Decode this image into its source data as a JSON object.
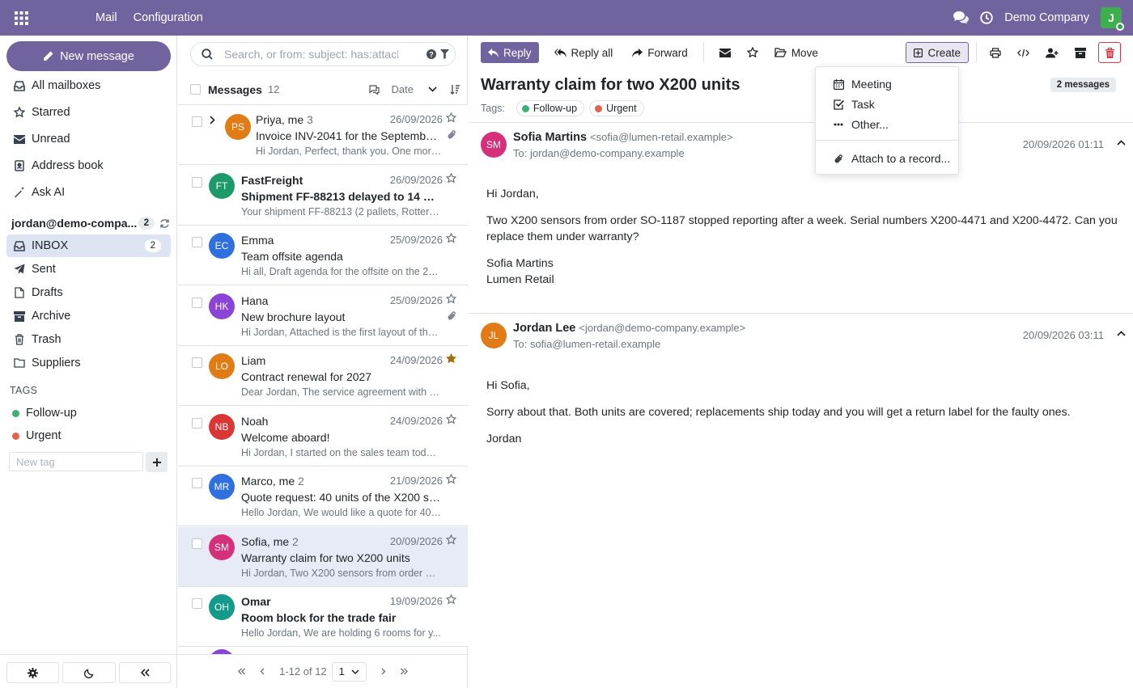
{
  "topbar": {
    "menu": [
      "Mail",
      "Configuration"
    ],
    "company": "Demo Company",
    "user_initial": "J",
    "bg_color": "#71639e"
  },
  "sidebar": {
    "new_message": "New message",
    "quick": [
      {
        "label": "All mailboxes",
        "icon": "inbox-icon"
      },
      {
        "label": "Starred",
        "icon": "star-icon"
      },
      {
        "label": "Unread",
        "icon": "envelope-icon"
      },
      {
        "label": "Address book",
        "icon": "address-book-icon"
      },
      {
        "label": "Ask AI",
        "icon": "magic-wand-icon"
      }
    ],
    "account": {
      "name": "jordan@demo-compa...",
      "count": "2"
    },
    "folders": [
      {
        "label": "INBOX",
        "count": "2",
        "icon": "inbox-icon",
        "active": true
      },
      {
        "label": "Sent",
        "icon": "send-icon"
      },
      {
        "label": "Drafts",
        "icon": "file-icon"
      },
      {
        "label": "Archive",
        "icon": "archive-icon"
      },
      {
        "label": "Trash",
        "icon": "trash-icon"
      },
      {
        "label": "Suppliers",
        "icon": "folder-icon"
      }
    ],
    "tags_title": "TAGS",
    "tags": [
      {
        "label": "Follow-up",
        "color": "#3bb273"
      },
      {
        "label": "Urgent",
        "color": "#e8604c"
      }
    ],
    "new_tag_placeholder": "New tag"
  },
  "list": {
    "search_placeholder": "Search, or from: subject: has:attachm",
    "header": {
      "title": "Messages",
      "count": "12",
      "sort": "Date"
    },
    "messages": [
      {
        "initials": "PS",
        "color": "#e07b16",
        "from": "Priya, me",
        "count": "3",
        "date": "26/09/2026",
        "subject": "Invoice INV-2041 for the September ...",
        "preview": "Hi Jordan, Perfect, thank you. One more ...",
        "unread": false,
        "starred": false,
        "attachment": true,
        "thread": true,
        "selected": false
      },
      {
        "initials": "FT",
        "color": "#1e9a6a",
        "from": "FastFreight",
        "count": "",
        "date": "26/09/2026",
        "subject": "Shipment FF-88213 delayed to 14 Octo...",
        "preview": "Your shipment FF-88213 (2 pallets, Rotterda...",
        "unread": true,
        "starred": false,
        "attachment": false,
        "thread": false,
        "selected": false
      },
      {
        "initials": "EC",
        "color": "#2f6fde",
        "from": "Emma",
        "count": "",
        "date": "25/09/2026",
        "subject": "Team offsite agenda",
        "preview": "Hi all, Draft agenda for the offsite on the 24...",
        "unread": false,
        "starred": false,
        "attachment": false,
        "thread": false,
        "selected": false
      },
      {
        "initials": "HK",
        "color": "#8a44d6",
        "from": "Hana",
        "count": "",
        "date": "25/09/2026",
        "subject": "New brochure layout",
        "preview": "Hi Jordan, Attached is the first layout of the ...",
        "unread": false,
        "starred": false,
        "attachment": true,
        "thread": false,
        "selected": false
      },
      {
        "initials": "LO",
        "color": "#e07b16",
        "from": "Liam",
        "count": "",
        "date": "24/09/2026",
        "subject": "Contract renewal for 2027",
        "preview": "Dear Jordan, The service agreement with Lu...",
        "unread": false,
        "starred": true,
        "attachment": false,
        "thread": false,
        "selected": false
      },
      {
        "initials": "NB",
        "color": "#d93636",
        "from": "Noah",
        "count": "",
        "date": "24/09/2026",
        "subject": "Welcome aboard!",
        "preview": "Hi Jordan, I started on the sales team today....",
        "unread": false,
        "starred": false,
        "attachment": false,
        "thread": false,
        "selected": false
      },
      {
        "initials": "MR",
        "color": "#2f6fde",
        "from": "Marco, me",
        "count": "2",
        "date": "21/09/2026",
        "subject": "Quote request: 40 units of the X200 sens...",
        "preview": "Hello Jordan, We would like a quote for 40 ...",
        "unread": false,
        "starred": false,
        "attachment": false,
        "thread": false,
        "selected": false
      },
      {
        "initials": "SM",
        "color": "#d62f7c",
        "from": "Sofia, me",
        "count": "2",
        "date": "20/09/2026",
        "subject": "Warranty claim for two X200 units",
        "preview": "Hi Jordan, Two X200 sensors from order SO...",
        "unread": false,
        "starred": false,
        "attachment": false,
        "thread": false,
        "selected": true
      },
      {
        "initials": "OH",
        "color": "#139a8a",
        "from": "Omar",
        "count": "",
        "date": "19/09/2026",
        "subject": "Room block for the trade fair",
        "preview": "Hello Jordan, We are holding 6 rooms for y...",
        "unread": true,
        "starred": false,
        "attachment": false,
        "thread": false,
        "selected": false
      }
    ],
    "pager": {
      "range": "1-12 of 12",
      "page": "1"
    }
  },
  "reader": {
    "toolbar": {
      "reply": "Reply",
      "reply_all": "Reply all",
      "forward": "Forward",
      "move": "Move",
      "create": "Create"
    },
    "subject": "Warranty claim for two X200 units",
    "message_count": "2 messages",
    "tags_label": "Tags:",
    "tags": [
      {
        "label": "Follow-up",
        "color": "#3bb273"
      },
      {
        "label": "Urgent",
        "color": "#e8604c"
      }
    ],
    "messages": [
      {
        "initials": "SM",
        "color": "#d62f7c",
        "name": "Sofia Martins",
        "email": "<sofia@lumen-retail.example>",
        "to": "To: jordan@demo-company.example",
        "date": "20/09/2026 01:11",
        "body": [
          "Hi Jordan,",
          "Two X200 sensors from order SO-1187 stopped reporting after a week. Serial numbers X200-4471 and X200-4472. Can you replace them under warranty?",
          "Sofia Martins",
          "Lumen Retail"
        ]
      },
      {
        "initials": "JL",
        "color": "#e07b16",
        "name": "Jordan Lee",
        "email": "<jordan@demo-company.example>",
        "to": "To: sofia@lumen-retail.example",
        "date": "20/09/2026 03:11",
        "body": [
          "Hi Sofia,",
          "Sorry about that. Both units are covered; replacements ship today and you will get a return label for the faulty ones.",
          "Jordan"
        ]
      }
    ]
  },
  "create_menu": {
    "items": [
      {
        "label": "Meeting",
        "icon": "calendar-icon"
      },
      {
        "label": "Task",
        "icon": "checkbox-icon"
      },
      {
        "label": "Other...",
        "icon": "ellipsis-icon"
      },
      {
        "label": "Attach to a record...",
        "icon": "paperclip-icon"
      }
    ]
  }
}
